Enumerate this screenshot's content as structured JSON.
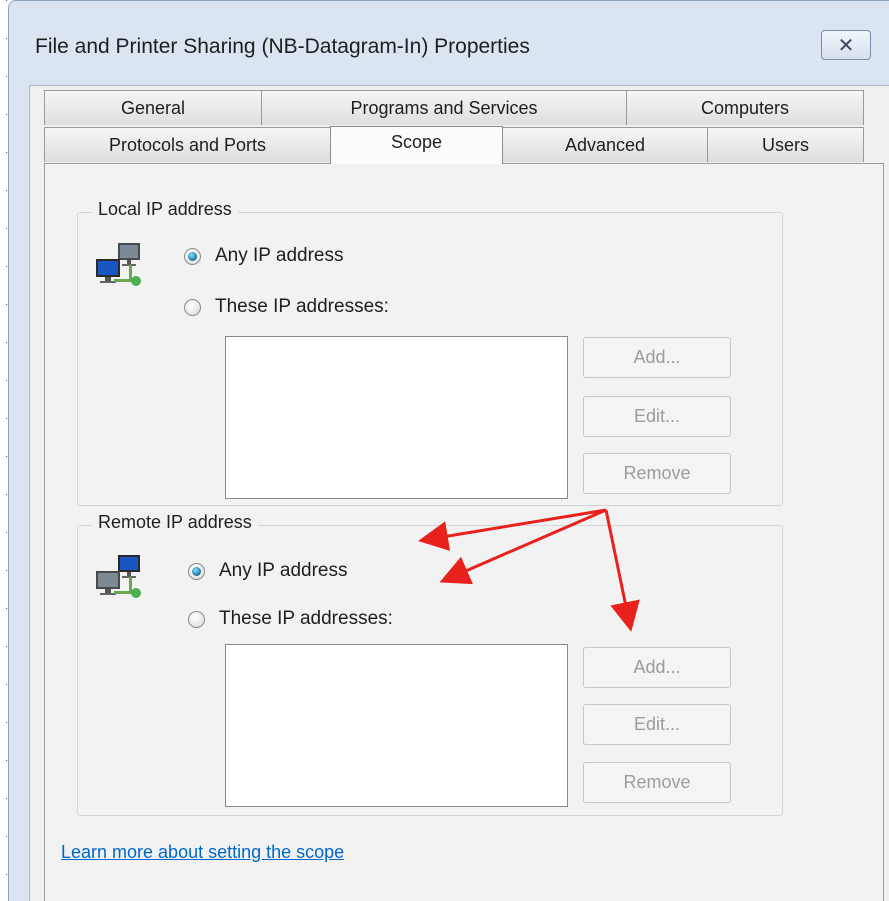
{
  "window": {
    "title": "File and Printer Sharing (NB-Datagram-In) Properties",
    "close_icon": "close-icon"
  },
  "tabs": {
    "row1": [
      "General",
      "Programs and Services",
      "Computers"
    ],
    "row2": [
      "Protocols and Ports",
      "Scope",
      "Advanced",
      "Users"
    ],
    "selected": "Scope"
  },
  "local": {
    "title": "Local IP address",
    "icon": "network-computers-icon",
    "any_label": "Any IP address",
    "these_label": "These IP addresses:",
    "selected": "Any IP address",
    "add": "Add...",
    "edit": "Edit...",
    "remove": "Remove"
  },
  "remote": {
    "title": "Remote IP address",
    "icon": "network-computers-icon",
    "any_label": "Any IP address",
    "these_label": "These IP addresses:",
    "selected": "Any IP address",
    "add": "Add...",
    "edit": "Edit...",
    "remove": "Remove"
  },
  "link": "Learn more about setting the scope",
  "colors": {
    "arrow": "#e8211c",
    "link": "#0066cc",
    "radio_selected": "#1a6f9a"
  }
}
